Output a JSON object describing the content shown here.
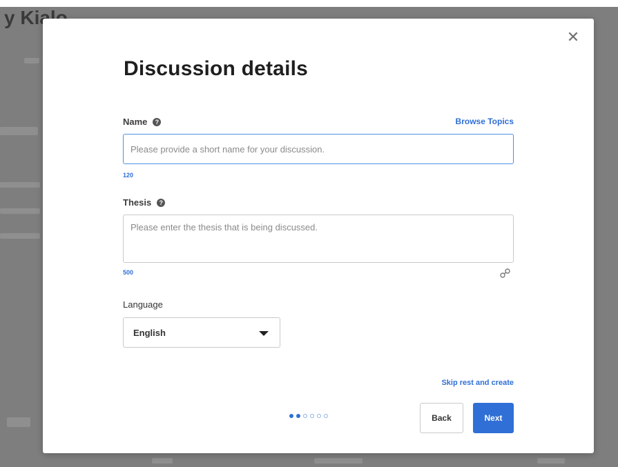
{
  "background": {
    "title": "y Kialo"
  },
  "modal": {
    "title": "Discussion details",
    "close_icon": "close-icon",
    "name_label": "Name",
    "browse_topics": "Browse Topics",
    "name_placeholder": "Please provide a short name for your discussion.",
    "name_counter": "120",
    "thesis_label": "Thesis",
    "thesis_placeholder": "Please enter the thesis that is being discussed.",
    "thesis_counter": "500",
    "language_label": "Language",
    "language_value": "English",
    "skip_label": "Skip rest and create",
    "progress": {
      "total_steps": 6,
      "current_step": 2
    },
    "back_label": "Back",
    "next_label": "Next"
  },
  "colors": {
    "accent": "#2f6fd6",
    "overlay": "#7e7e7e"
  }
}
